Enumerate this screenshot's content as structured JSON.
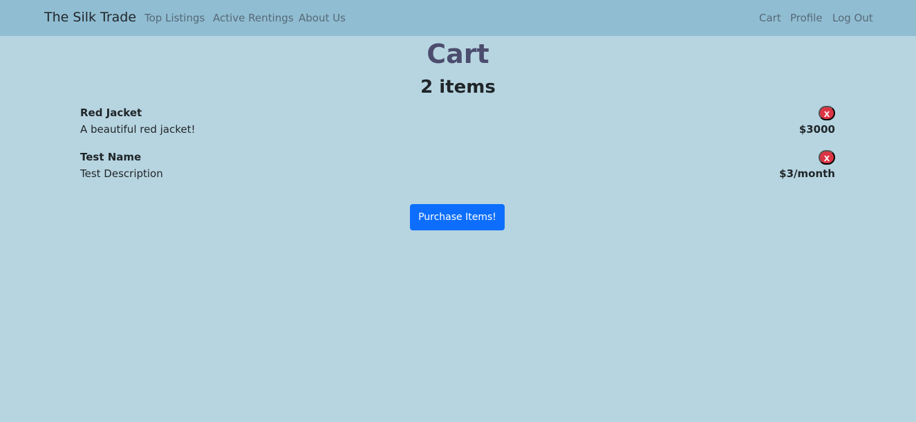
{
  "navbar": {
    "brand": "The Silk Trade",
    "left_links": [
      "Top Listings",
      "Active Rentings",
      "About Us"
    ],
    "right_links": [
      "Cart",
      "Profile",
      "Log Out"
    ]
  },
  "cart": {
    "title": "Cart",
    "item_count": "2 items",
    "items": [
      {
        "name": "Red Jacket",
        "description": "A beautiful red jacket!",
        "price": "$3000",
        "remove_label": "x"
      },
      {
        "name": "Test Name",
        "description": "Test Description",
        "price": "$3/month",
        "remove_label": "x"
      }
    ],
    "purchase_label": "Purchase Items!"
  },
  "colors": {
    "page_background": "#b7d5e0",
    "navbar_background": "#91bdd2",
    "title_color": "#4c4d6e",
    "remove_button": "#dc3545",
    "primary_button": "#0d6efd"
  }
}
